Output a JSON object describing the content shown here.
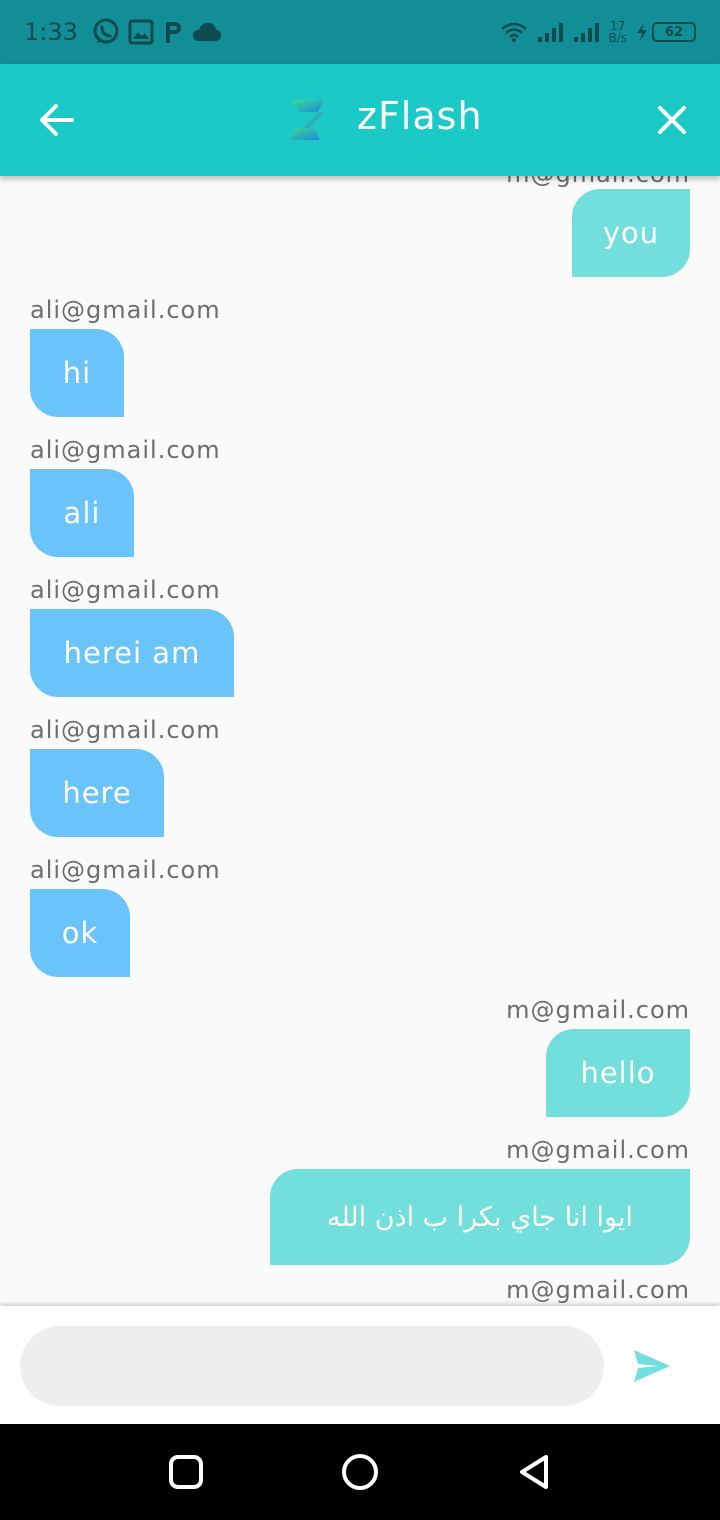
{
  "status_bar": {
    "time": "1:33",
    "net_speed_value": "17",
    "net_speed_unit": "B/s",
    "battery": "62",
    "icons_left": [
      "whatsapp-icon",
      "image-icon",
      "paypal-icon",
      "cloud-icon"
    ],
    "icons_right": [
      "wifi-icon",
      "signal-icon",
      "signal-icon",
      "charging-icon"
    ]
  },
  "app_bar": {
    "title": "zFlash",
    "color": "#1bcac7"
  },
  "messages": [
    {
      "sender": "m@gmail.com",
      "text": "you",
      "direction": "out"
    },
    {
      "sender": "ali@gmail.com",
      "text": "hi",
      "direction": "in"
    },
    {
      "sender": "ali@gmail.com",
      "text": "ali",
      "direction": "in"
    },
    {
      "sender": "ali@gmail.com",
      "text": "herei am",
      "direction": "in"
    },
    {
      "sender": "ali@gmail.com",
      "text": "here",
      "direction": "in"
    },
    {
      "sender": "ali@gmail.com",
      "text": "ok",
      "direction": "in"
    },
    {
      "sender": "m@gmail.com",
      "text": "hello",
      "direction": "out"
    },
    {
      "sender": "m@gmail.com",
      "text": "ايوا انا جاي بكرا ب اذن الله",
      "direction": "out"
    },
    {
      "sender": "m@gmail.com",
      "text": "",
      "direction": "out"
    }
  ],
  "input": {
    "value": "",
    "placeholder": ""
  },
  "colors": {
    "incoming_bubble": "#6ac3f9",
    "outgoing_bubble": "#72dfdc",
    "send_icon": "#72dfdc"
  }
}
